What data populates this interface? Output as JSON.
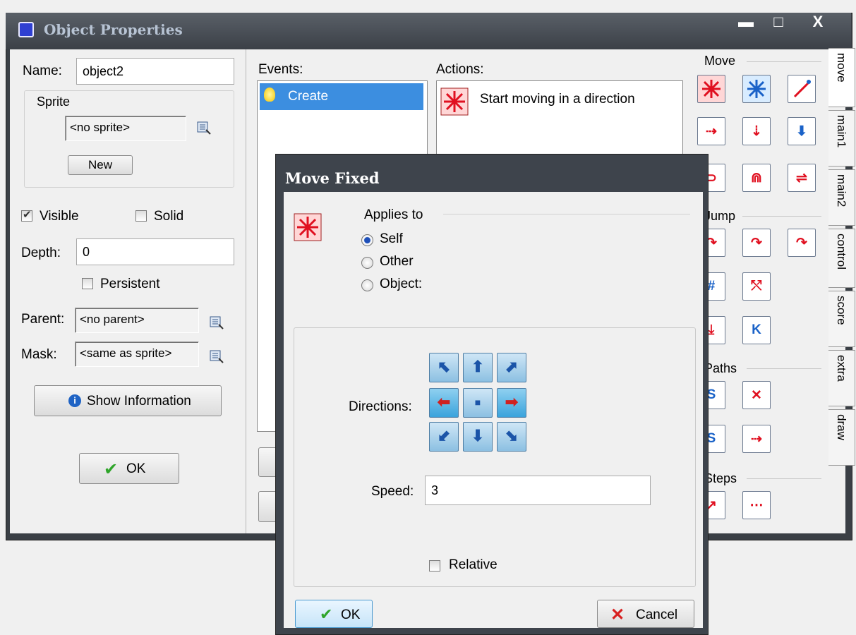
{
  "window": {
    "title": "Object Properties",
    "controls": {
      "minimize": "▬",
      "maximize": "□",
      "close": "X"
    }
  },
  "object": {
    "name_label": "Name:",
    "name_value": "object2",
    "sprite_group": "Sprite",
    "sprite_value": "<no sprite>",
    "new_button": "New",
    "visible_label": "Visible",
    "visible_checked": true,
    "solid_label": "Solid",
    "solid_checked": false,
    "depth_label": "Depth:",
    "depth_value": "0",
    "persistent_label": "Persistent",
    "persistent_checked": false,
    "parent_label": "Parent:",
    "parent_value": "<no parent>",
    "mask_label": "Mask:",
    "mask_value": "<same as sprite>",
    "show_info_button": "Show Information",
    "ok_button": "OK"
  },
  "events": {
    "label": "Events:",
    "items": [
      "Create"
    ]
  },
  "actions": {
    "label": "Actions:",
    "items": [
      "Start moving in a direction"
    ]
  },
  "palette": {
    "sections": [
      "Move",
      "Jump",
      "Paths",
      "Steps"
    ],
    "tabs": [
      "move",
      "main1",
      "main2",
      "control",
      "score",
      "extra",
      "draw"
    ]
  },
  "dialog": {
    "title": "Move Fixed",
    "applies_to_label": "Applies to",
    "options": [
      "Self",
      "Other",
      "Object:"
    ],
    "selected_option": "Self",
    "directions_label": "Directions:",
    "direction_arrows": [
      "⬉",
      "⬆",
      "⬈",
      "⬅",
      "■",
      "➡",
      "⬋",
      "⬇",
      "⬊"
    ],
    "selected_directions": [
      "left",
      "right"
    ],
    "speed_label": "Speed:",
    "speed_value": "3",
    "relative_label": "Relative",
    "relative_checked": false,
    "ok_button": "OK",
    "cancel_button": "Cancel"
  },
  "colors": {
    "titlebar": "#3b4047",
    "selection": "#3c8ee0",
    "action_icon": "#e02030",
    "direction_button": "#8cc0e2"
  }
}
